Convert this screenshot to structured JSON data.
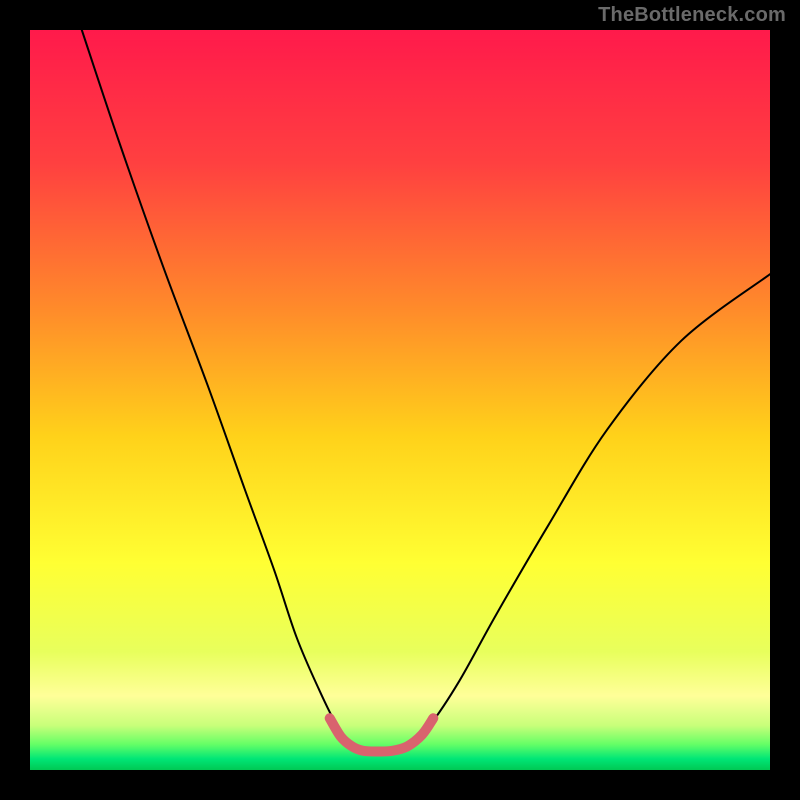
{
  "watermark": "TheBottleneck.com",
  "chart_data": {
    "type": "line",
    "title": "",
    "xlabel": "",
    "ylabel": "",
    "xlim": [
      0,
      100
    ],
    "ylim": [
      0,
      100
    ],
    "background_gradient": {
      "stops": [
        {
          "offset": 0.0,
          "color": "#ff1a4b"
        },
        {
          "offset": 0.18,
          "color": "#ff4040"
        },
        {
          "offset": 0.38,
          "color": "#ff8c2a"
        },
        {
          "offset": 0.55,
          "color": "#ffd21a"
        },
        {
          "offset": 0.72,
          "color": "#ffff33"
        },
        {
          "offset": 0.84,
          "color": "#e8ff5c"
        },
        {
          "offset": 0.9,
          "color": "#ffff99"
        },
        {
          "offset": 0.94,
          "color": "#c8ff7a"
        },
        {
          "offset": 0.965,
          "color": "#66ff66"
        },
        {
          "offset": 0.985,
          "color": "#00e676"
        },
        {
          "offset": 1.0,
          "color": "#00c853"
        }
      ]
    },
    "series": [
      {
        "name": "bottleneck-curve",
        "x": [
          7,
          12,
          18,
          24,
          29,
          33,
          36,
          39,
          41.5,
          44,
          47,
          51,
          54,
          58,
          63,
          70,
          78,
          88,
          100
        ],
        "values": [
          100,
          85,
          68,
          52,
          38,
          27,
          18,
          11,
          6,
          3,
          2.5,
          3,
          6,
          12,
          21,
          33,
          46,
          58,
          67
        ],
        "color": "#000000",
        "width": 2
      },
      {
        "name": "highlight-segment",
        "x": [
          40.5,
          42,
          43.5,
          45,
          47,
          49,
          51,
          53,
          54.5
        ],
        "values": [
          7,
          4.5,
          3.2,
          2.6,
          2.5,
          2.6,
          3.2,
          4.8,
          7
        ],
        "color": "#d9636e",
        "width": 10
      }
    ]
  }
}
